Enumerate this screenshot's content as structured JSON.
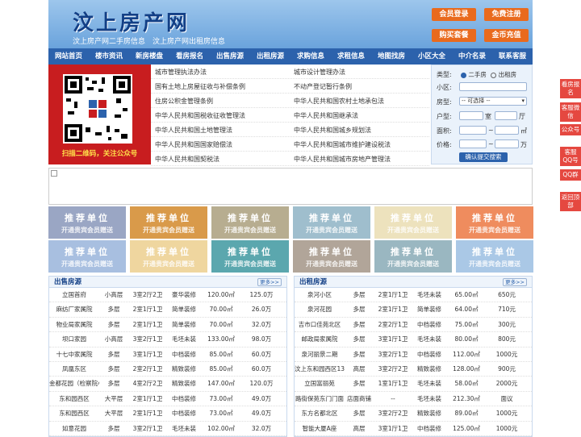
{
  "header": {
    "logo": "汶上房产网",
    "slogan": "汶上房产网二手房信息　汶上房产网出租房信息",
    "buttons": [
      "会员登录",
      "免费注册",
      "购买套餐",
      "金币充值"
    ]
  },
  "nav": [
    "网站首页",
    "楼市资讯",
    "新房楼盘",
    "看房报名",
    "出售房源",
    "出租房源",
    "求购信息",
    "求租信息",
    "地图找房",
    "小区大全",
    "中介名录",
    "联系客服"
  ],
  "qr": {
    "caption": "扫描二维码，关注公众号"
  },
  "links_left": [
    "城市管理执法办法",
    "国有土地上房屋征收与补偿条例",
    "住房公积金管理条例",
    "中华人民共和国税收征收管理法",
    "中华人民共和国土地管理法",
    "中华人民共和国国家赔偿法",
    "中华人民共和国契税法"
  ],
  "links_right": [
    "城市设计管理办法",
    "不动产登记暂行条例",
    "中华人民共和国农村土地承包法",
    "中华人民共和国继承法",
    "中华人民共和国城乡规划法",
    "中华人民共和国城市维护建设税法",
    "中华人民共和国城市房地产管理法"
  ],
  "search": {
    "type_label": "类型:",
    "type_opt1": "二手房",
    "type_opt2": "出租房",
    "xiaoqu_label": "小区:",
    "fangxing_label": "房型:",
    "fangxing_value": "-- 可选择 --",
    "huxing_label": "户型:",
    "shi": "室",
    "ting": "厅",
    "area_label": "面积:",
    "area_unit": "㎡",
    "price_label": "价格:",
    "price_unit": "万",
    "submit": "确认提交搜索"
  },
  "recommend": {
    "title": "推荐单位",
    "sub": "开通贵宾会员赠送"
  },
  "sale": {
    "title": "出售房源",
    "more": "更多>>",
    "rows": [
      [
        "立国首府",
        "小高层",
        "3室2厅2卫",
        "豪华装修",
        "120.00㎡",
        "125.0万"
      ],
      [
        "麻纺厂家属院",
        "多层",
        "2室1厅1卫",
        "简单装修",
        "70.00㎡",
        "26.0万"
      ],
      [
        "物业局家属院",
        "多层",
        "2室1厅1卫",
        "简单装修",
        "70.00㎡",
        "32.0万"
      ],
      [
        "坝口家园",
        "小高层",
        "3室2厅1卫",
        "毛坯未装",
        "133.00㎡",
        "98.0万"
      ],
      [
        "十七中家属院",
        "多层",
        "3室1厅1卫",
        "中档装修",
        "85.00㎡",
        "60.0万"
      ],
      [
        "凤凰东区",
        "多层",
        "2室2厅1卫",
        "精致装修",
        "85.00㎡",
        "60.0万"
      ],
      [
        "金都花园（检察院小区",
        "多层",
        "4室2厅2卫",
        "精致装修",
        "147.00㎡",
        "120.0万"
      ],
      [
        "东和园西区",
        "大平层",
        "2室1厅1卫",
        "中档装修",
        "73.00㎡",
        "49.0万"
      ],
      [
        "东和园西区",
        "大平层",
        "2室1厅1卫",
        "中档装修",
        "73.00㎡",
        "49.0万"
      ],
      [
        "如意花园",
        "多层",
        "3室2厅1卫",
        "毛坯未装",
        "102.00㎡",
        "32.0万"
      ]
    ]
  },
  "rent": {
    "title": "出租房源",
    "more": "更多>>",
    "rows": [
      [
        "泉河小区",
        "多层",
        "2室1厅1卫",
        "毛坯未装",
        "65.00㎡",
        "650元"
      ],
      [
        "泉河花园",
        "多层",
        "2室1厅1卫",
        "简单装修",
        "64.00㎡",
        "710元"
      ],
      [
        "吉市口佳苑北区",
        "多层",
        "2室2厅1卫",
        "中档装修",
        "75.00㎡",
        "300元"
      ],
      [
        "邮政局家属院",
        "多层",
        "3室1厅1卫",
        "毛坯未装",
        "80.00㎡",
        "800元"
      ],
      [
        "泉河丽景二期",
        "多层",
        "3室2厅1卫",
        "中档装修",
        "112.00㎡",
        "1000元"
      ],
      [
        "汶上东和园西区13号",
        "高层",
        "3室2厅2卫",
        "精致装修",
        "128.00㎡",
        "900元"
      ],
      [
        "立国富丽苑",
        "多层",
        "1室1厅1卫",
        "毛坯未装",
        "58.00㎡",
        "2000元"
      ],
      [
        "路街保苑东门门面",
        "店面商铺",
        "--",
        "毛坯未装",
        "212.30㎡",
        "面议"
      ],
      [
        "东方名都北区",
        "多层",
        "3室2厅2卫",
        "精致装修",
        "89.00㎡",
        "1000元"
      ],
      [
        "智能大厦A座",
        "高层",
        "3室1厅1卫",
        "中档装修",
        "125.00㎡",
        "1000元"
      ]
    ]
  },
  "side": [
    "看房报名",
    "客服微信",
    "公众号",
    "客服QQ号",
    "QQ群",
    "返回顶部"
  ]
}
